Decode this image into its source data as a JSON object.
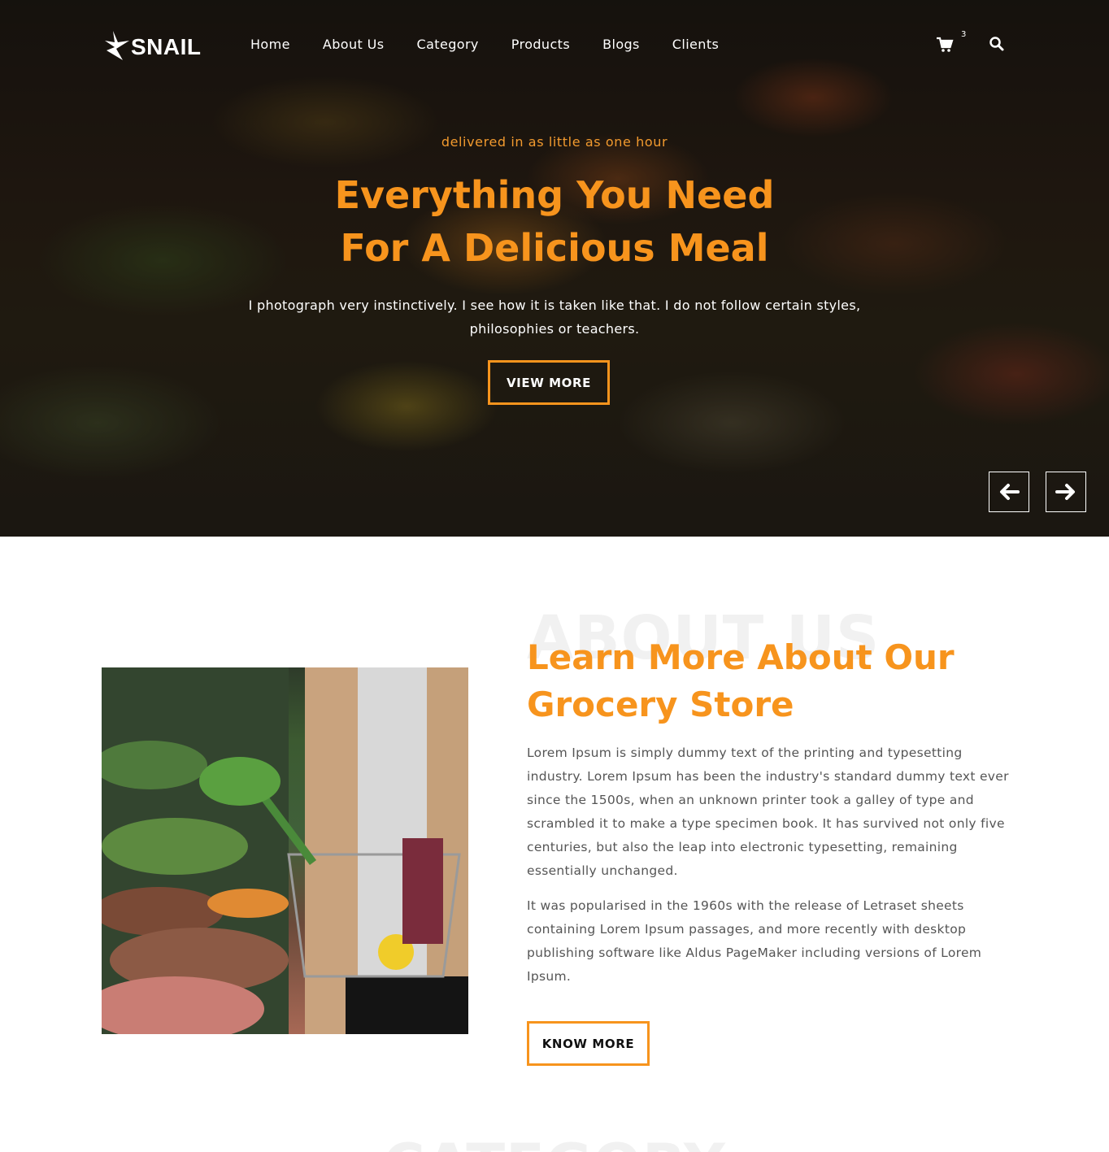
{
  "brand": {
    "name": "SNAIL",
    "accent": "#f7941d"
  },
  "nav": {
    "items": [
      {
        "label": "Home"
      },
      {
        "label": "About Us"
      },
      {
        "label": "Category"
      },
      {
        "label": "Products"
      },
      {
        "label": "Blogs"
      },
      {
        "label": "Clients"
      }
    ]
  },
  "header": {
    "cart_icon": "cart-icon",
    "cart_count": "3",
    "search_icon": "search-icon"
  },
  "hero": {
    "subtitle": "delivered in as little as one hour",
    "title_line1": "Everything You Need",
    "title_line2": "For A Delicious Meal",
    "text": "I photograph very instinctively. I see how it is taken like that. I do not follow certain styles, philosophies or teachers.",
    "button_label": "VIEW MORE",
    "prev_icon": "arrow-left-icon",
    "next_icon": "arrow-right-icon"
  },
  "about": {
    "watermark": "ABOUT US",
    "title_line1": "Learn More About Our",
    "title_line2": "Grocery Store",
    "paragraph1": "Lorem Ipsum is simply dummy text of the printing and typesetting industry. Lorem Ipsum has been the industry's standard dummy text ever since the 1500s, when an unknown printer took a galley of type and scrambled it to make a type specimen book. It has survived not only five centuries, but also the leap into electronic typesetting, remaining essentially unchanged.",
    "paragraph2": "It was popularised in the 1960s with the release of Letraset sheets containing Lorem Ipsum passages, and more recently with desktop publishing software like Aldus PageMaker including versions of Lorem Ipsum.",
    "button_label": "KNOW MORE"
  },
  "category": {
    "watermark": "CATEGORY"
  }
}
